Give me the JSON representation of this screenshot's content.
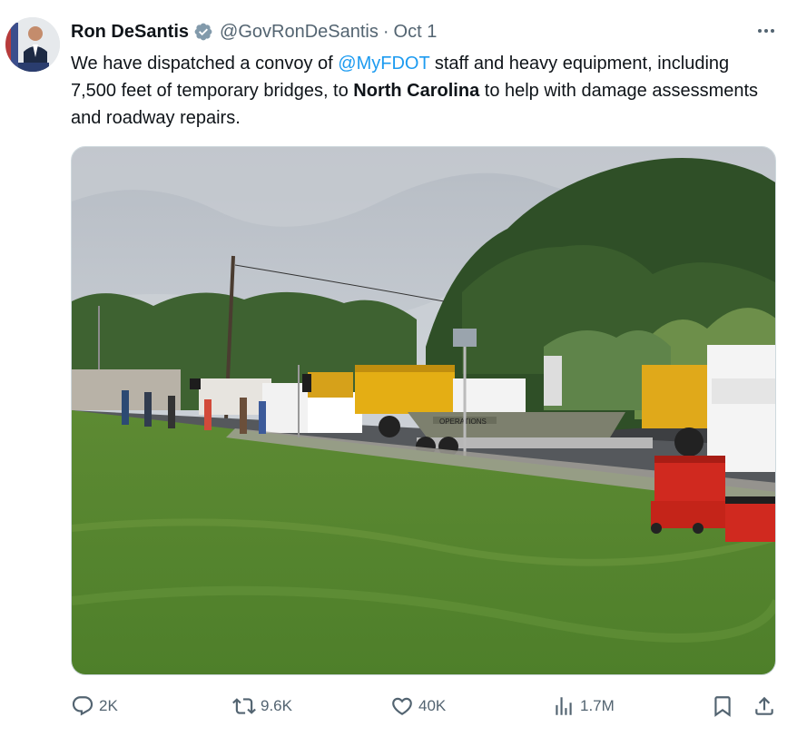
{
  "author": {
    "name": "Ron DeSantis",
    "handle": "@GovRonDeSantis",
    "separator": "·",
    "timestamp": "Oct 1",
    "verified": true
  },
  "tweet": {
    "text_part1": "We have dispatched a convoy of ",
    "mention": "@MyFDOT",
    "text_part2": " staff and heavy equipment, including 7,500 feet of temporary bridges, to ",
    "bold_location": "North Carolina",
    "text_part3": " to help with damage assessments and roadway repairs."
  },
  "media": {
    "type": "photo",
    "boat_hull_text": "OPERATIONS"
  },
  "metrics": {
    "replies": "2K",
    "reposts": "9.6K",
    "likes": "40K",
    "views": "1.7M"
  },
  "colors": {
    "accent": "#1d9bf0",
    "secondary_text": "#536471",
    "verified_badge": "#829aab"
  },
  "icons": [
    "more-icon",
    "verified-badge-icon",
    "reply-icon",
    "repost-icon",
    "like-icon",
    "views-icon",
    "bookmark-icon",
    "share-icon"
  ]
}
